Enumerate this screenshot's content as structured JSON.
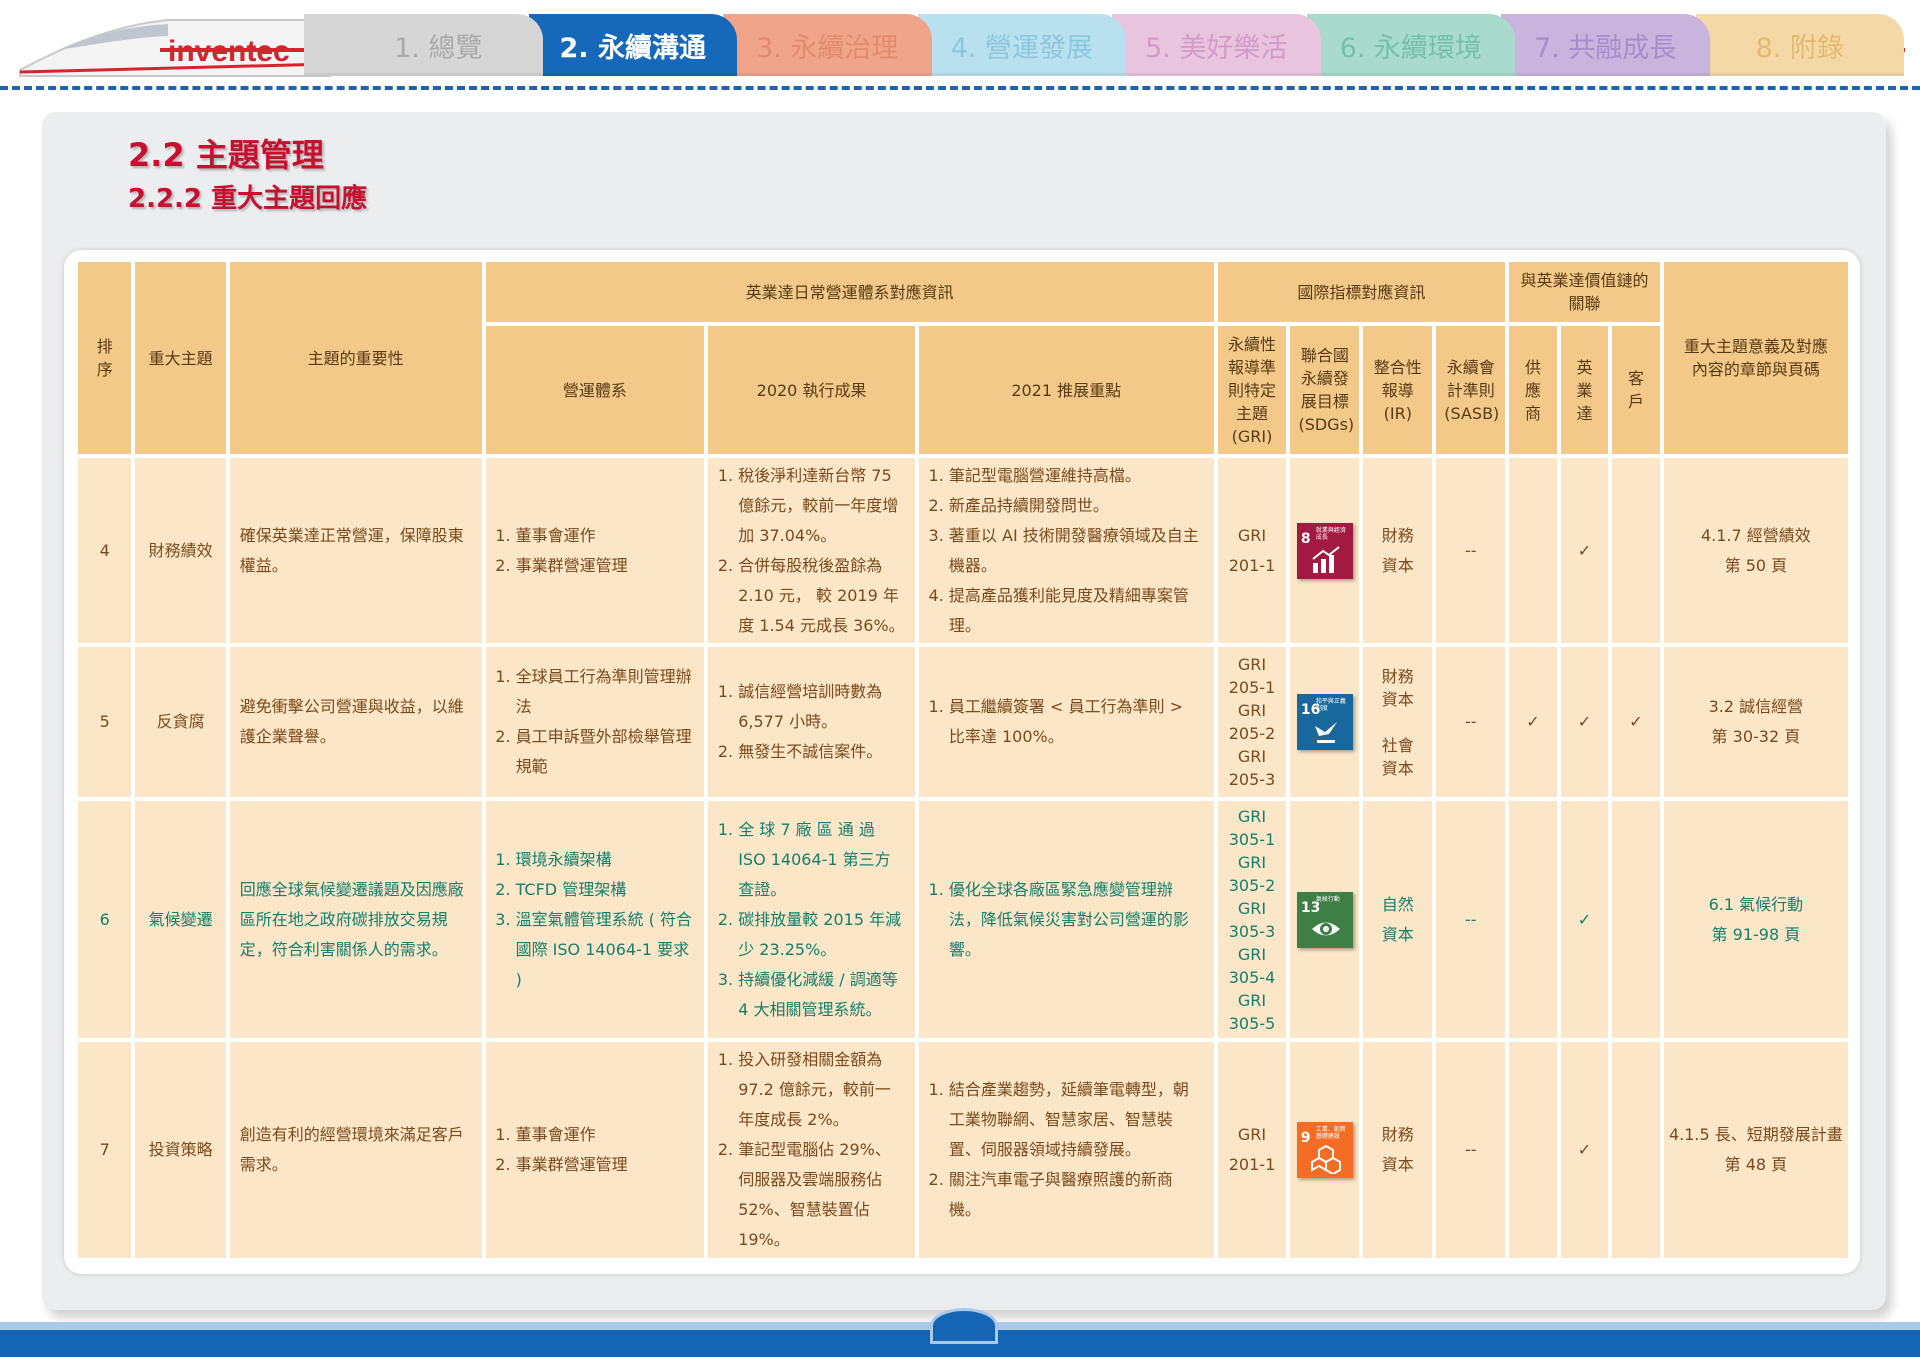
{
  "logo": "inventec",
  "nav": {
    "tabs": [
      {
        "label": "1. 總覽",
        "bg": "#d6d6d6",
        "color": "#a9a9a9"
      },
      {
        "label": "2. 永續溝通",
        "bg": "#1668b8",
        "color": "#ffffff",
        "active": true
      },
      {
        "label": "3. 永續治理",
        "bg": "#f0a58a",
        "color": "#e08b70"
      },
      {
        "label": "4. 營運發展",
        "bg": "#b8e0ee",
        "color": "#8dc7dc"
      },
      {
        "label": "5. 美好樂活",
        "bg": "#e8c4df",
        "color": "#d39cc6"
      },
      {
        "label": "6. 永續環境",
        "bg": "#a9dbcc",
        "color": "#76c0aa"
      },
      {
        "label": "7. 共融成長",
        "bg": "#c8b4dd",
        "color": "#a88dcb"
      },
      {
        "label": "8. 附錄",
        "bg": "#f4d9a6",
        "color": "#e3b970"
      }
    ]
  },
  "heading": {
    "title": "2.2 主題管理",
    "subtitle": "2.2.2 重大主題回應"
  },
  "table": {
    "headers": {
      "rank": "排序",
      "topic": "重大主題",
      "importance": "主題的重要性",
      "group_inventec": "英業達日常營運體系對應資訊",
      "system": "營運體系",
      "result2020": "2020 執行成果",
      "focus2021": "2021 推展重點",
      "group_intl": "國際指標對應資訊",
      "gri": "永續性報導準則特定主題 (GRI)",
      "sdgs": "聯合國永續發展目標 (SDGs)",
      "ir": "整合性報導 (IR)",
      "sasb": "永續會計準則 (SASB)",
      "group_value": "與英業達價值鏈的關聯",
      "supplier": "供應商",
      "inventec": "英業達",
      "customer": "客戶",
      "chapter": "重大主題意義及對應內容的章節與頁碼"
    },
    "rows": [
      {
        "rank": "4",
        "topic": "財務績效",
        "importance": "確保英業達正常營運，保障股東權益。",
        "system": [
          "董事會運作",
          "事業群營運管理"
        ],
        "result2020": [
          "稅後淨利達新台幣 75 億餘元，較前一年度增加 37.04%。",
          "合併每股稅後盈餘為 2.10 元， 較 2019 年 度 1.54 元成長 36%。"
        ],
        "focus2021": [
          "筆記型電腦營運維持高檔。",
          "新產品持續開發問世。",
          "著重以 AI 技術開發醫療領域及自主機器。",
          "提高產品獲利能見度及精細專案管理。"
        ],
        "gri": [
          "GRI",
          "201-1"
        ],
        "sdg": {
          "num": "8",
          "label": "就業與經濟成長",
          "color": "#a21942",
          "icon": "chart-icon"
        },
        "ir": [
          "財務",
          "資本"
        ],
        "sasb": "--",
        "supplier": "",
        "inventec": "✓",
        "customer": "",
        "chapter": [
          "4.1.7 經營績效",
          "第 50 頁"
        ],
        "green": false
      },
      {
        "rank": "5",
        "topic": "反貪腐",
        "importance": "避免衝擊公司營運與收益，以維護企業聲譽。",
        "system": [
          "全球員工行為準則管理辦法",
          "員工申訴暨外部檢舉管理規範"
        ],
        "result2020": [
          "誠信經營培訓時數為 6,577 小時。",
          "無發生不誠信案件。"
        ],
        "focus2021": [
          "員工繼續簽署 < 員工行為準則 > 比率達 100%。"
        ],
        "gri": [
          "GRI",
          "205-1",
          "GRI",
          "205-2",
          "GRI",
          "205-3"
        ],
        "sdg": {
          "num": "16",
          "label": "和平與正義制度",
          "color": "#19689d",
          "icon": "dove-icon"
        },
        "ir": [
          "財務",
          "資本",
          "",
          "社會",
          "資本"
        ],
        "sasb": "--",
        "supplier": "✓",
        "inventec": "✓",
        "customer": "✓",
        "chapter": [
          "3.2 誠信經營",
          "第 30-32 頁"
        ],
        "green": false
      },
      {
        "rank": "6",
        "topic": "氣候變遷",
        "importance": "回應全球氣候變遷議題及因應廠區所在地之政府碳排放交易規定，符合利害關係人的需求。",
        "system": [
          "環境永續架構",
          "TCFD 管理架構",
          "溫室氣體管理系統 ( 符合國際 ISO 14064-1 要求 )"
        ],
        "result2020": [
          "全 球 7 廠 區 通 過 ISO 14064-1 第三方查證。",
          "碳排放量較 2015 年減少 23.25%。",
          "持續優化減緩 / 調適等 4 大相關管理系統。"
        ],
        "focus2021": [
          "優化全球各廠區緊急應變管理辦法，降低氣候災害對公司營運的影響。"
        ],
        "gri": [
          "GRI",
          "305-1",
          "GRI",
          "305-2",
          "GRI",
          "305-3",
          "GRI",
          "305-4",
          "GRI",
          "305-5"
        ],
        "sdg": {
          "num": "13",
          "label": "氣候行動",
          "color": "#3f7e44",
          "icon": "eye-globe-icon"
        },
        "ir": [
          "自然",
          "資本"
        ],
        "sasb": "--",
        "supplier": "",
        "inventec": "✓",
        "customer": "",
        "chapter": [
          "6.1 氣候行動",
          "第 91-98 頁"
        ],
        "green": true
      },
      {
        "rank": "7",
        "topic": "投資策略",
        "importance": "創造有利的經營環境來滿足客戶需求。",
        "system": [
          "董事會運作",
          "事業群營運管理"
        ],
        "result2020": [
          "投入研發相關金額為 97.2 億餘元，較前一年度成長 2%。",
          "筆記型電腦佔 29%、伺服器及雲端服務佔 52%、智慧裝置佔 19%。"
        ],
        "focus2021": [
          "結合產業趨勢，延續筆電轉型，朝工業物聯網、智慧家居、智慧裝置、伺服器領域持續發展。",
          "關注汽車電子與醫療照護的新商機。"
        ],
        "gri": [
          "GRI",
          "201-1"
        ],
        "sdg": {
          "num": "9",
          "label": "工業、創新基礎建設",
          "color": "#f36d25",
          "icon": "cubes-icon"
        },
        "ir": [
          "財務",
          "資本"
        ],
        "sasb": "--",
        "supplier": "",
        "inventec": "✓",
        "customer": "",
        "chapter": [
          "4.1.5 長、短期發展計畫",
          "第 48 頁"
        ],
        "green": false
      }
    ]
  }
}
